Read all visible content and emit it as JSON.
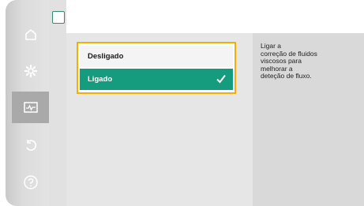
{
  "sidebar": {
    "items": [
      {
        "name": "home",
        "icon": "home-icon",
        "active": false
      },
      {
        "name": "settings",
        "icon": "gear-icon",
        "active": false
      },
      {
        "name": "diagnostics",
        "icon": "monitor-graph-icon",
        "active": true
      },
      {
        "name": "restore",
        "icon": "undo-icon",
        "active": false
      },
      {
        "name": "help",
        "icon": "question-icon",
        "active": false
      }
    ]
  },
  "options": [
    {
      "label": "Desligado",
      "selected": false
    },
    {
      "label": "Ligado",
      "selected": true
    }
  ],
  "help": {
    "lines": [
      "Ligar a",
      "correção de fluidos",
      "viscosos para",
      "melhorar a",
      "deteção de fluxo."
    ]
  },
  "colors": {
    "accent": "#159b7d",
    "focus": "#f2b000",
    "sidebar_active": "#a9a9a9"
  }
}
